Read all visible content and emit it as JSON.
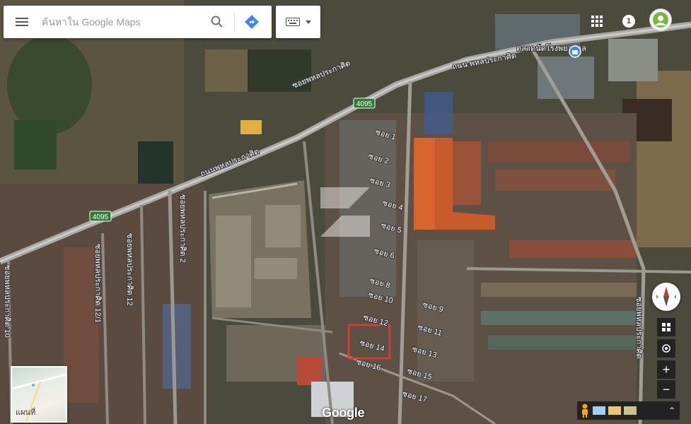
{
  "search": {
    "placeholder": "ค้นหาใน Google Maps"
  },
  "header": {
    "notification_count": "1"
  },
  "map": {
    "type": "satellite",
    "road_labels": [
      "ถนนพหลประกาศิต",
      "ถนน พหลประกาศิต",
      "ซอยพหลประกาศิต 2",
      "ซอยพหลประกาศิต 12/1",
      "ซอยพหลประกาศิต 12",
      "ซอยพหลประกาศิต 10",
      "ซอยพหลประกาศิต",
      "ซอยพหลประกาศิต"
    ],
    "route_shields": [
      "4095",
      "4095"
    ],
    "place_label": "ตลาดนัดโรงพยาบาล",
    "soi_labels": [
      "ซอย 1",
      "ซอย 2",
      "ซอย 3",
      "ซอย 4",
      "ซอย 5",
      "ซอย 6",
      "ซอย 8",
      "ซอย 10",
      "ซอย 9",
      "ซอย 12",
      "ซอย 11",
      "ซอย 14",
      "ซอย 13",
      "ซอย 16",
      "ซอย 15",
      "ซอย 17"
    ],
    "highlighted_soi": "ซอย 14",
    "highlight_color": "#e53935"
  },
  "thumbnail": {
    "label": "แผนที่"
  },
  "controls": {
    "zoom_in": "+",
    "zoom_out": "−"
  },
  "logo": "Google",
  "colors": {
    "directions": "#4285f4",
    "compass_red": "#d32f2f",
    "pegman": "#f2a900"
  }
}
